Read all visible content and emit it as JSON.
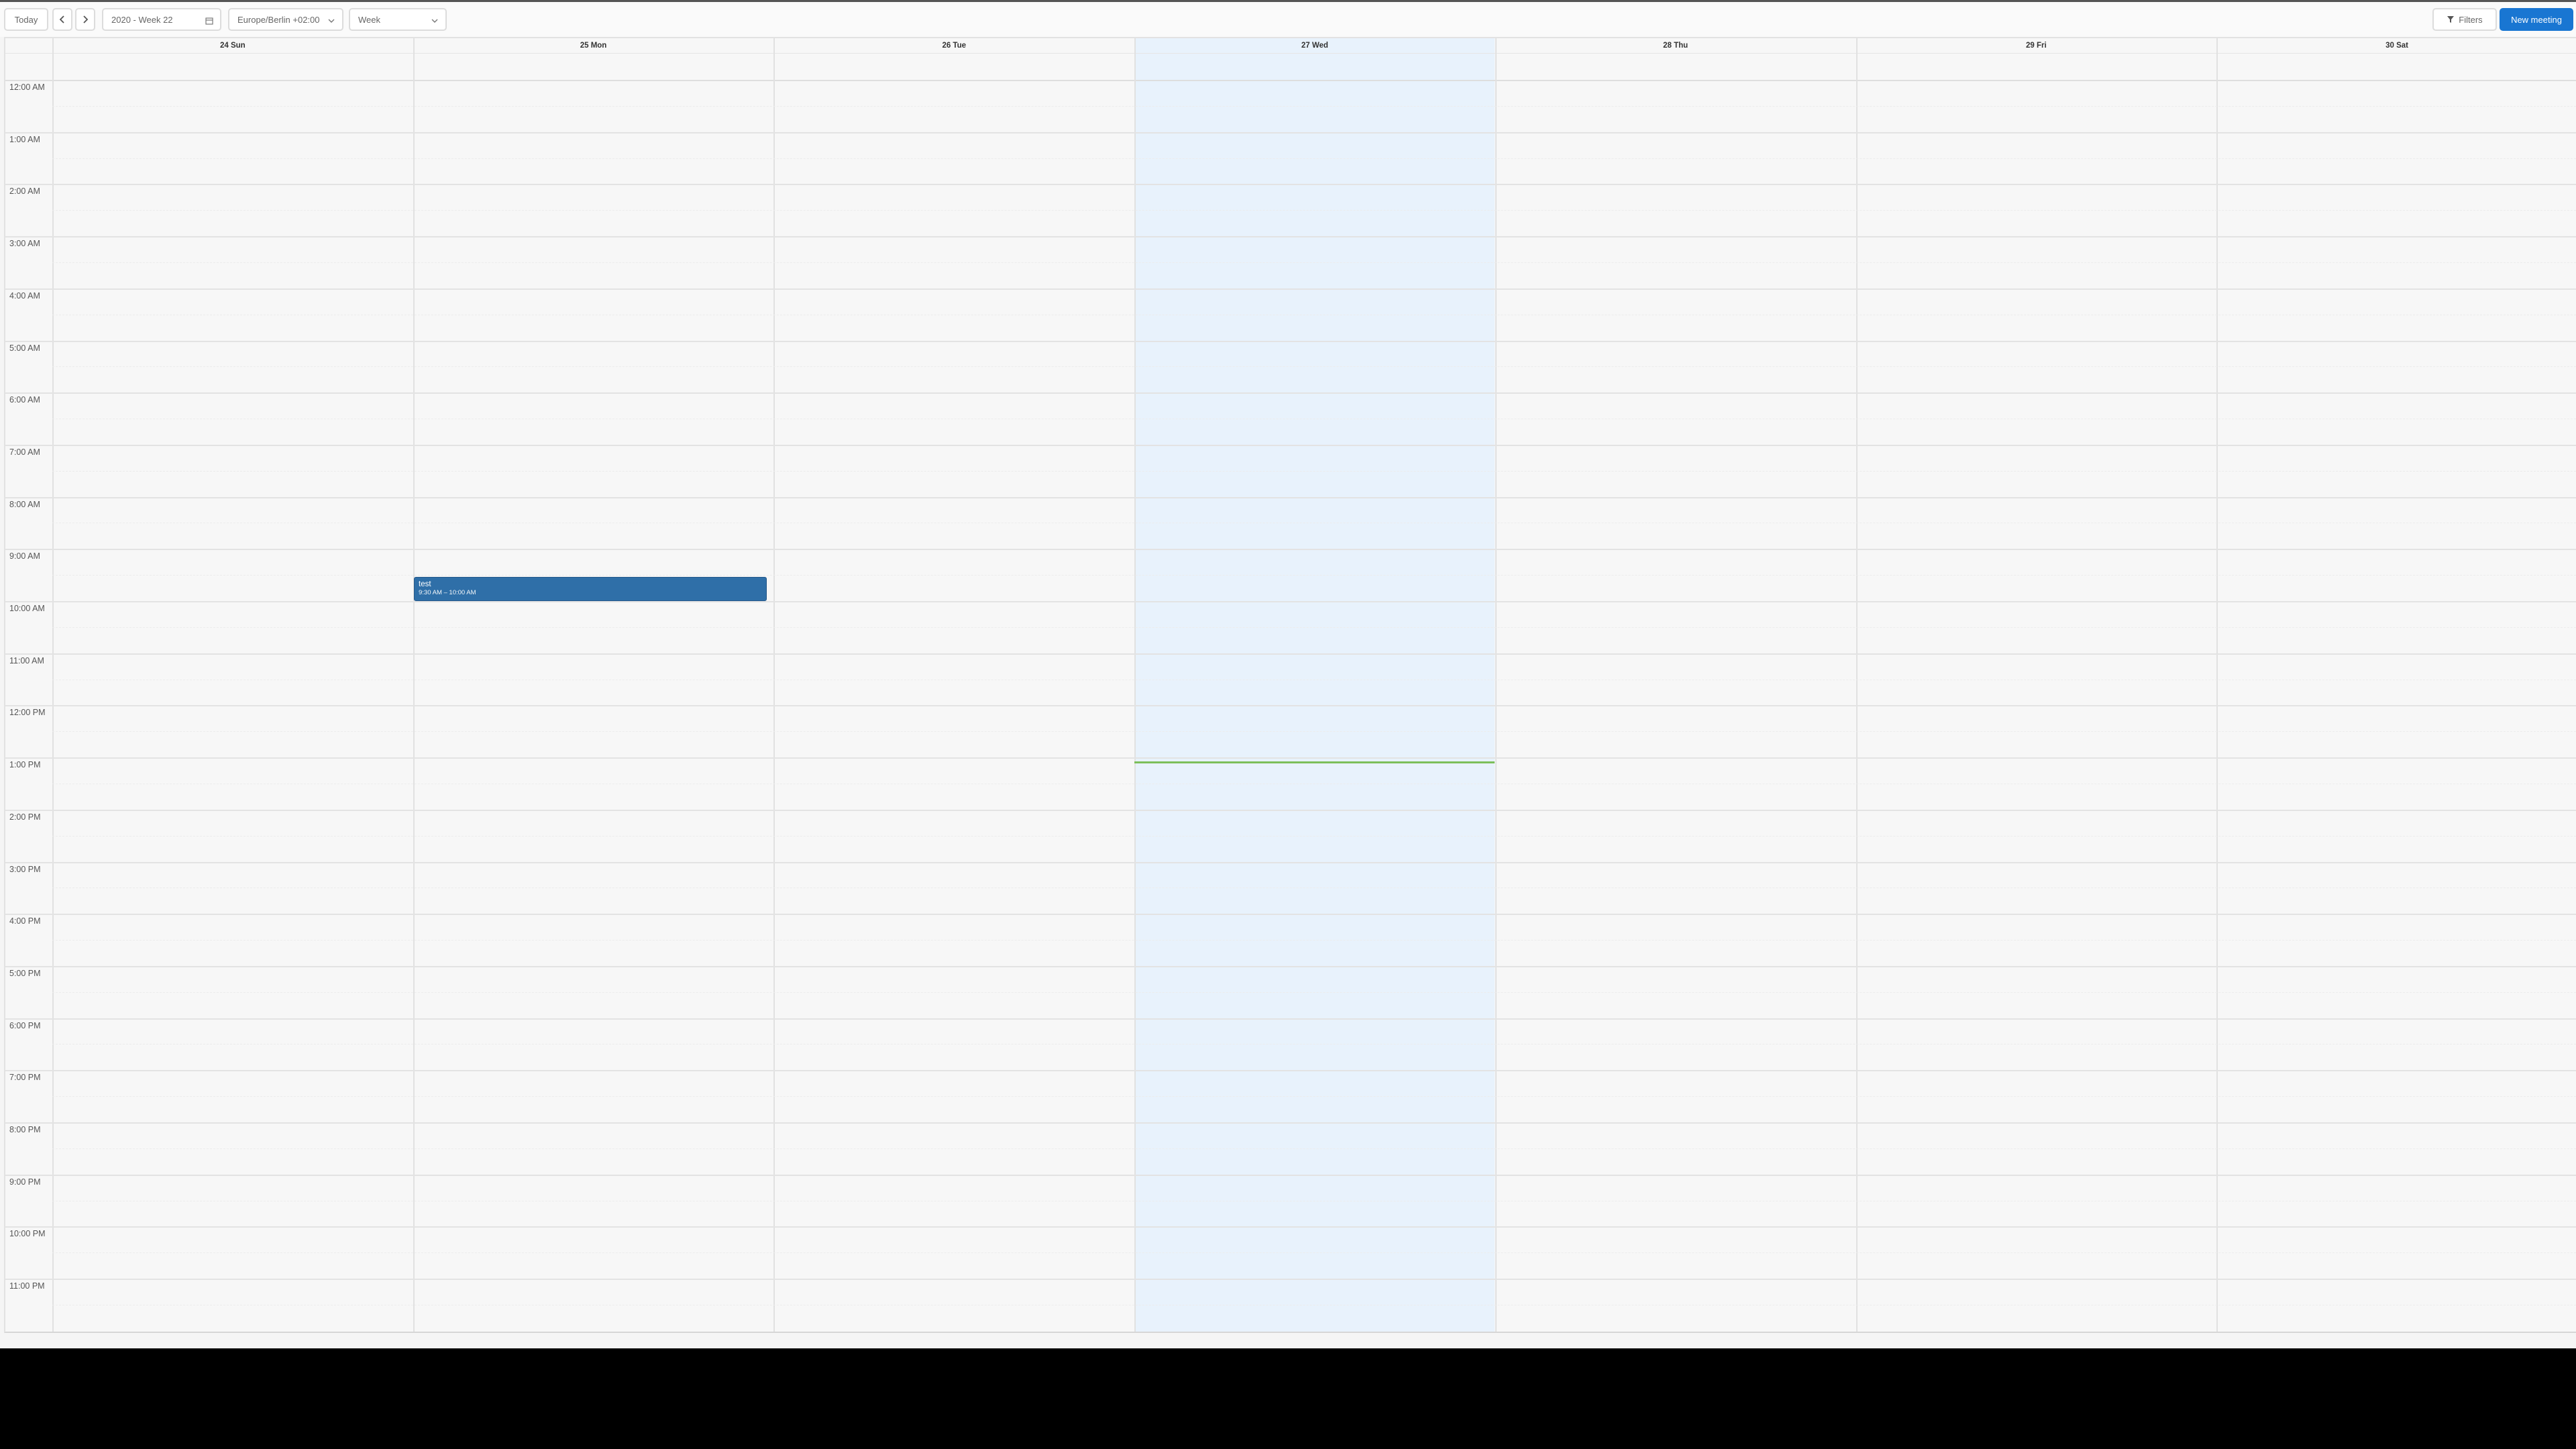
{
  "toolbar": {
    "today_label": "Today",
    "period_value": "2020 - Week 22",
    "timezone_value": "Europe/Berlin +02:00",
    "view_value": "Week",
    "filters_label": "Filters",
    "new_meeting_label": "New meeting"
  },
  "calendar": {
    "days": [
      {
        "label": "24 Sun"
      },
      {
        "label": "25 Mon"
      },
      {
        "label": "26 Tue"
      },
      {
        "label": "27 Wed",
        "today": true
      },
      {
        "label": "28 Thu"
      },
      {
        "label": "29 Fri"
      },
      {
        "label": "30 Sat"
      }
    ],
    "hours": [
      "12:00 AM",
      "1:00 AM",
      "2:00 AM",
      "3:00 AM",
      "4:00 AM",
      "5:00 AM",
      "6:00 AM",
      "7:00 AM",
      "8:00 AM",
      "9:00 AM",
      "10:00 AM",
      "11:00 AM",
      "12:00 PM",
      "1:00 PM",
      "2:00 PM",
      "3:00 PM",
      "4:00 PM",
      "5:00 PM",
      "6:00 PM",
      "7:00 PM",
      "8:00 PM",
      "9:00 PM",
      "10:00 PM",
      "11:00 PM"
    ],
    "events": [
      {
        "title": "test",
        "time": "9:30 AM – 10:00 AM",
        "day": "25 Mon"
      }
    ]
  },
  "colors": {
    "primary": "#1976d2",
    "event": "#2f6fa8",
    "today_bg": "#e8f2fc",
    "now_line": "#7cbf5a"
  }
}
